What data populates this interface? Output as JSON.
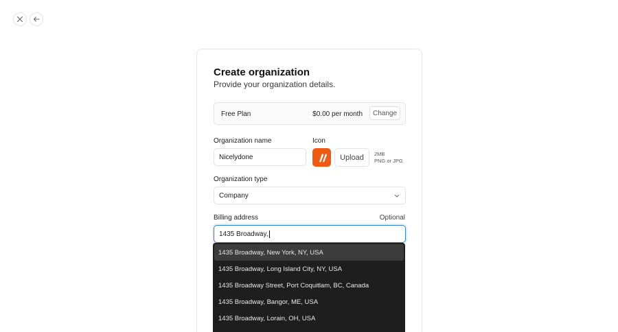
{
  "nav": {
    "close_icon": "close-icon",
    "back_icon": "arrow-left-icon"
  },
  "form": {
    "title": "Create organization",
    "subtitle": "Provide your organization details.",
    "plan": {
      "name": "Free Plan",
      "price": "$0.00 per month",
      "change_label": "Change"
    },
    "org_name": {
      "label": "Organization name",
      "value": "Nicelydone"
    },
    "icon": {
      "label": "Icon",
      "upload_label": "Upload",
      "hint_size": "2MB",
      "hint_types": "PNG or JPG",
      "brand_color": "#f05a12"
    },
    "org_type": {
      "label": "Organization type",
      "value": "Company"
    },
    "billing": {
      "label": "Billing address",
      "optional_label": "Optional",
      "value": "1435 Broadway,"
    }
  },
  "suggestions": [
    "1435 Broadway, New York, NY, USA",
    "1435 Broadway, Long Island City, NY, USA",
    "1435 Broadway Street, Port Coquitlam, BC, Canada",
    "1435 Broadway, Bangor, ME, USA",
    "1435 Broadway, Lorain, OH, USA"
  ],
  "colors": {
    "focus": "#2e7fd6",
    "dropdown_bg": "#1e1e1e",
    "dropdown_active": "#3c3c3c"
  }
}
